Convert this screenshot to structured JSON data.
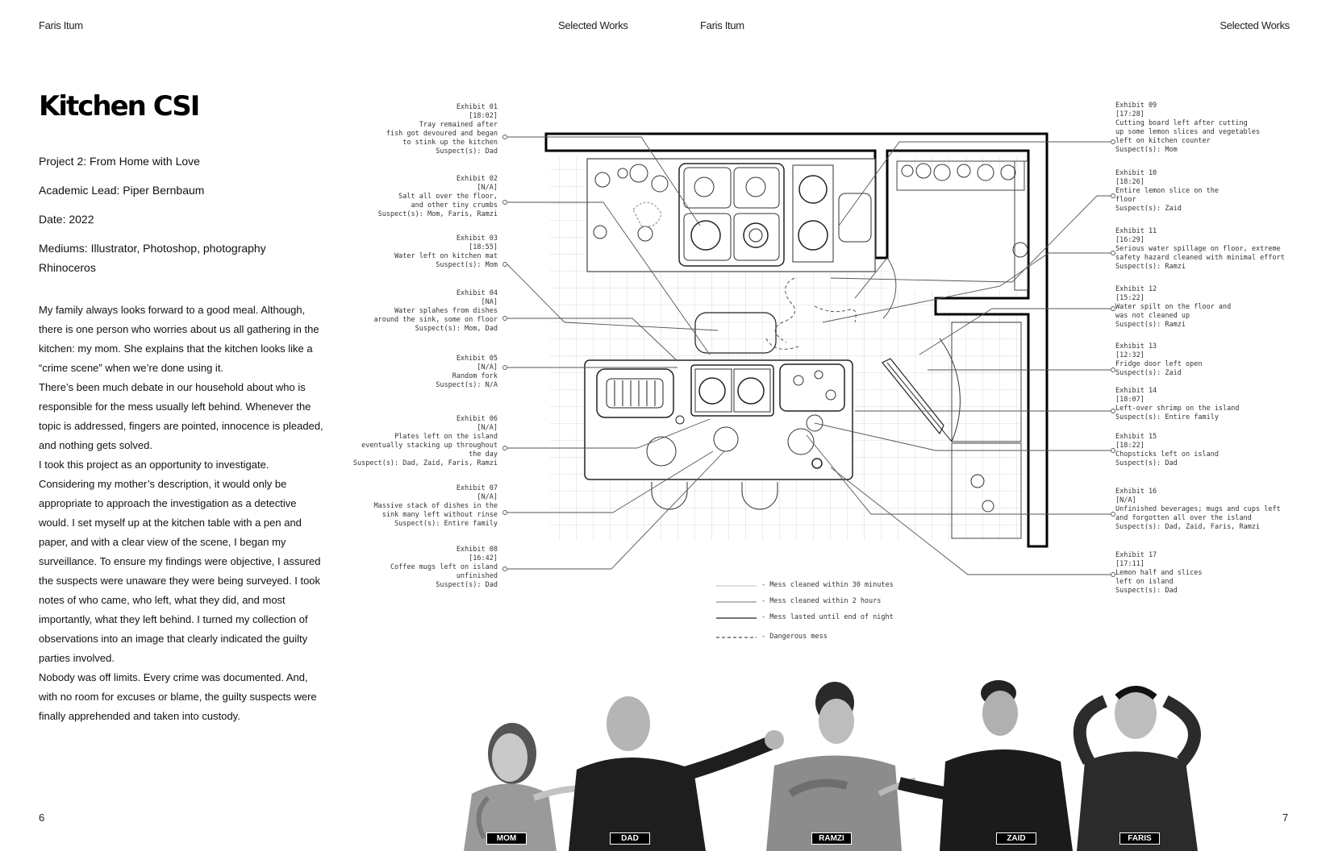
{
  "header": {
    "author_left": "Faris Itum",
    "section_left": "Selected Works",
    "author_right": "Faris Itum",
    "section_right": "Selected Works"
  },
  "project": {
    "title": "Kitchen CSI",
    "project_line": "Project 2: From Home with Love",
    "lead_line": "Academic Lead: Piper Bernbaum",
    "date_line": "Date: 2022",
    "mediums_line1": "Mediums: Illustrator, Photoshop, photography",
    "mediums_line2": "Rhinoceros",
    "body": [
      "My family always looks forward to a good meal. Although, there is one person who worries about us all gathering in the kitchen: my mom. She explains that the kitchen looks like a “crime scene” when we’re done using it.",
      "There’s been much debate in our household about who is responsible for the mess usually left behind. Whenever the topic is addressed, fingers are pointed, innocence is pleaded, and nothing gets solved.",
      "I took this project as an opportunity to investigate. Considering my mother’s description, it would only be appropriate to approach the investigation as a detective would. I set myself up at the kitchen table with a pen and paper, and with a clear view of the scene, I began my surveillance. To ensure my findings were objective, I assured the suspects were unaware they were being surveyed. I took notes of who came, who left, what they did, and most importantly, what they left behind. I turned my collection of observations into an image that clearly indicated the guilty parties involved.",
      "Nobody was off limits. Every crime was documented. And, with no room for excuses or blame, the guilty suspects were finally apprehended and taken into custody."
    ]
  },
  "exhibits_left": [
    {
      "text": "Exhibit 01\n[18:02]\nTray remained after\nfish got devoured and began\nto stink up the kitchen\nSuspect(s): Dad"
    },
    {
      "text": "Exhibit 02\n[N/A]\nSalt all over the floor,\nand other tiny crumbs\nSuspect(s): Mom, Faris, Ramzi"
    },
    {
      "text": "Exhibit 03\n[18:55]\nWater left on kitchen mat\nSuspect(s): Mom"
    },
    {
      "text": "Exhibit 04\n[NA]\nWater splahes from dishes\naround the sink, some on floor\nSuspect(s): Mom, Dad"
    },
    {
      "text": "Exhibit 05\n[N/A]\nRandom fork\nSuspect(s): N/A"
    },
    {
      "text": "Exhibit 06\n[N/A]\nPlates left on the island\neventually stacking up throughout\nthe day\nSuspect(s): Dad, Zaid, Faris, Ramzi"
    },
    {
      "text": "Exhibit 07\n[N/A]\nMassive stack of dishes in the\nsink many left without rinse\nSuspect(s): Entire family"
    },
    {
      "text": "Exhibit 08\n[16:42]\nCoffee mugs left on island\nunfinished\nSuspect(s): Dad"
    }
  ],
  "exhibits_right": [
    {
      "text": "Exhibit 09\n[17:28]\nCutting board left after cutting\nup some lemon slices and vegetables\nleft on kitchen counter\nSuspect(s): Mom"
    },
    {
      "text": "Exhibit 10\n[18:26]\nEntire lemon slice on the\nfloor\nSuspect(s): Zaid"
    },
    {
      "text": "Exhibit 11\n[16:29]\nSerious water spillage on floor, extreme\nsafety hazard cleaned with minimal effort\nSuspect(s): Ramzi"
    },
    {
      "text": "Exhibit 12\n[15:22]\nWater spilt on the floor and\nwas not cleaned up\nSuspect(s): Ramzi"
    },
    {
      "text": "Exhibit 13\n[12:32]\nFridge door left open\nSuspect(s): Zaid"
    },
    {
      "text": "Exhibit 14\n[18:07]\nLeft-over shrimp on the island\nSuspect(s): Entire family"
    },
    {
      "text": "Exhibit 15\n[18:22]\nChopsticks left on island\nSuspect(s): Dad"
    },
    {
      "text": "Exhibit 16\n[N/A]\nUnfinished beverages; mugs and cups left\nand forgotten all over the island\nSuspect(s): Dad, Zaid, Faris, Ramzi"
    },
    {
      "text": "Exhibit 17\n[17:11]\nLemon half and slices\nleft on island\nSuspect(s): Dad"
    }
  ],
  "legend": [
    "- Mess cleaned within 30 minutes",
    "- Mess cleaned within 2 hours",
    "- Mess lasted until end of night",
    "- Dangerous mess"
  ],
  "suspects": [
    "MOM",
    "DAD",
    "RAMZI",
    "ZAID",
    "FARIS"
  ],
  "page_numbers": {
    "left": "6",
    "right": "7"
  }
}
